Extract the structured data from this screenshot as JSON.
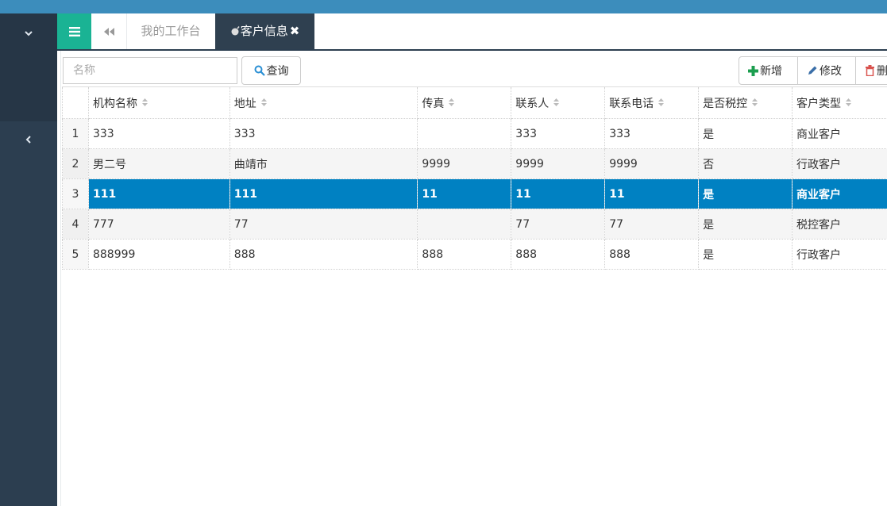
{
  "tabs": {
    "home": "我的工作台",
    "active": "客户信息",
    "close_glyph": "✖"
  },
  "toolbar": {
    "search_placeholder": "名称",
    "search_label": "查询",
    "add_label": "新增",
    "edit_label": "修改",
    "delete_label": "删"
  },
  "table": {
    "columns": [
      "机构名称",
      "地址",
      "传真",
      "联系人",
      "联系电话",
      "是否税控",
      "客户类型"
    ],
    "rows": [
      {
        "no": "1",
        "cells": [
          "333",
          "333",
          "",
          "333",
          "333",
          "是",
          "商业客户"
        ]
      },
      {
        "no": "2",
        "cells": [
          "男二号",
          "曲靖市",
          "9999",
          "9999",
          "9999",
          "否",
          "行政客户"
        ]
      },
      {
        "no": "3",
        "cells": [
          "111",
          "111",
          "11",
          "11",
          "11",
          "是",
          "商业客户"
        ]
      },
      {
        "no": "4",
        "cells": [
          "777",
          "77",
          "",
          "77",
          "77",
          "是",
          "税控客户"
        ]
      },
      {
        "no": "5",
        "cells": [
          "888999",
          "888",
          "888",
          "888",
          "888",
          "是",
          "行政客户"
        ]
      }
    ],
    "selected_row": 3
  },
  "colors": {
    "accent": "#1ab394",
    "sidebar": "#2c3e50",
    "selected_row": "#0081c2",
    "top_strip": "#3c8dbc"
  }
}
